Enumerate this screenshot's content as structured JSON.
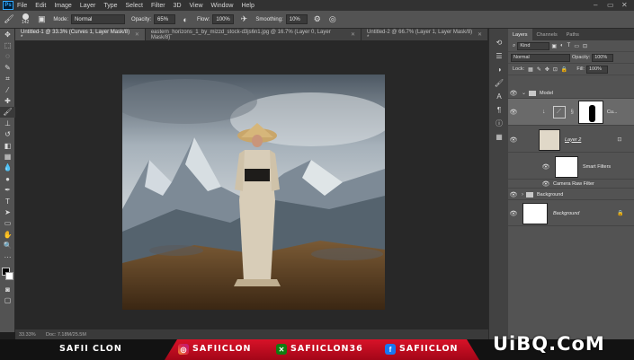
{
  "app": {
    "logo": "Ps"
  },
  "menu": [
    "File",
    "Edit",
    "Image",
    "Layer",
    "Type",
    "Select",
    "Filter",
    "3D",
    "View",
    "Window",
    "Help"
  ],
  "window_controls": [
    "–",
    "▭",
    "✕"
  ],
  "options": {
    "brush_size": "142",
    "mode_label": "Mode:",
    "mode_value": "Normal",
    "opacity_label": "Opacity:",
    "opacity_value": "65%",
    "flow_label": "Flow:",
    "flow_value": "100%",
    "smoothing_label": "Smoothing:",
    "smoothing_value": "10%"
  },
  "doc_tabs": [
    {
      "label": "Untitled-1 @ 33.3% (Curves 1, Layer Mask/8) *",
      "active": true
    },
    {
      "label": "eastern_horizons_1_by_mizzd_stock-d3js6n1.jpg @ 16.7% (Layer 0, Layer Mask/8)",
      "active": false
    },
    {
      "label": "Untitled-2 @ 66.7% (Layer 1, Layer Mask/8) *",
      "active": false
    }
  ],
  "status": {
    "zoom": "33.33%",
    "doc": "Doc: 7.18M/25.5M"
  },
  "panels": {
    "tabs": [
      "Layers",
      "Channels",
      "Paths"
    ],
    "kind": "Kind",
    "blend": "Normal",
    "opacity_label": "Opacity:",
    "opacity_value": "100%",
    "lock_label": "Lock:",
    "fill_label": "Fill:",
    "fill_value": "100%"
  },
  "layers": [
    {
      "name": "Model",
      "type": "group"
    },
    {
      "name": "Cu...",
      "type": "adjustment"
    },
    {
      "name": "Layer 2",
      "type": "smart"
    },
    {
      "name": "Smart Filters",
      "type": "filter"
    },
    {
      "name": "Camera Raw Filter",
      "type": "filter-item"
    },
    {
      "name": "Background",
      "type": "group"
    },
    {
      "name": "Background",
      "type": "background"
    }
  ],
  "banner": {
    "name": "SAFII CLON",
    "instagram": "SAFIICLON",
    "xbox": "SAFIICLON36",
    "facebook": "SAFIICLON",
    "watermark": "UiBQ.CoM"
  },
  "colors": {
    "accent": "#31a8ff",
    "banner_red": "#d81228"
  }
}
